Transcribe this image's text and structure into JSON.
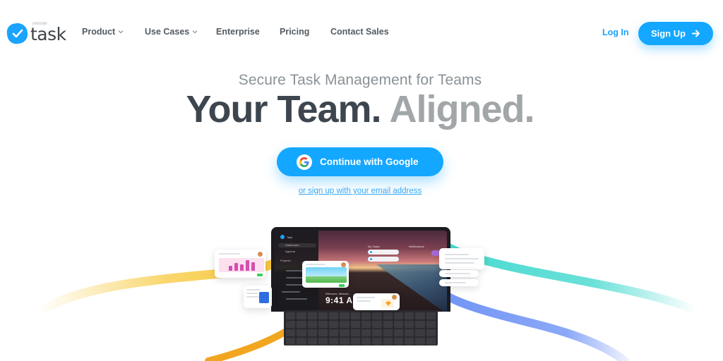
{
  "brand": {
    "name": "task",
    "prefix": "meister",
    "accent_color": "#14a7ff"
  },
  "nav": {
    "items": [
      {
        "label": "Product",
        "has_dropdown": true
      },
      {
        "label": "Use Cases",
        "has_dropdown": true
      },
      {
        "label": "Enterprise",
        "has_dropdown": false
      },
      {
        "label": "Pricing",
        "has_dropdown": false
      },
      {
        "label": "Contact Sales",
        "has_dropdown": false
      }
    ],
    "login_label": "Log In",
    "signup_label": "Sign Up",
    "signup_icon": "arrow-right-icon"
  },
  "hero": {
    "subtitle": "Secure Task Management for Teams",
    "headline_dark": "Your Team.",
    "headline_light": "Aligned.",
    "google_button_label": "Continue with Google",
    "google_icon": "google-g-icon",
    "email_link_label": "or sign up with your email address"
  },
  "illustration": {
    "app_brand": "Task",
    "sidebar_items": [
      "Dashboard",
      "Agenda"
    ],
    "sidebar_section": "Projects",
    "widget_my_tasks": "My Tasks",
    "widget_notifications": "Notifications",
    "greeting": "Welcome, Michael",
    "clock": "9:41 AM",
    "ribbon_colors": {
      "yellow": "#f7c530",
      "orange": "#f2a51f",
      "teal": "#45d9cf",
      "blue": "#6e93f5"
    },
    "chart_card_bars": [
      0.45,
      0.7,
      0.55,
      0.95,
      0.75
    ]
  }
}
